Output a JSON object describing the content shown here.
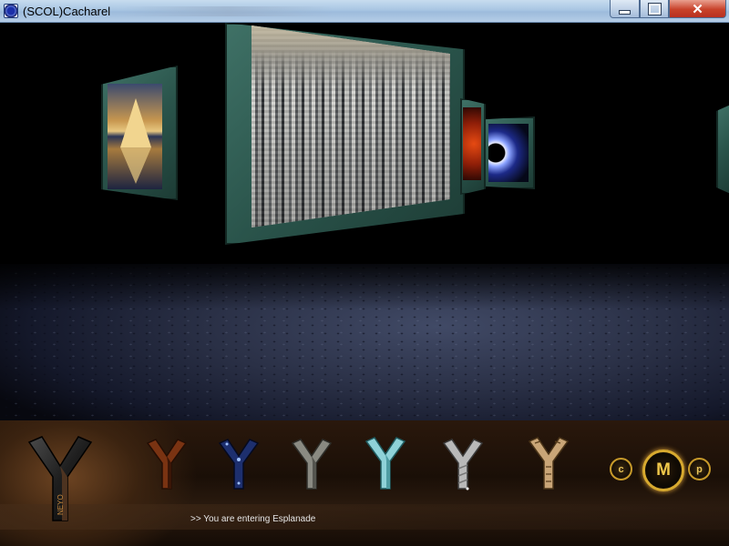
{
  "window": {
    "title": "(SCOL)Cacharel",
    "buttons": {
      "minimize": "minimize",
      "maximize": "maximize",
      "close": "✕"
    }
  },
  "scene": {
    "pictures": [
      "iceberg-picture",
      "city-skyline-picture",
      "red-nebula-picture",
      "eclipse-picture",
      "partial-frame"
    ]
  },
  "toolbar": {
    "main_logo_label": "NEYO",
    "nav_icons": [
      {
        "name": "rust-y-icon",
        "color": "#7a3312"
      },
      {
        "name": "blue-y-icon",
        "color": "#1d2f6e"
      },
      {
        "name": "stone-y-icon",
        "color": "#8a8a82"
      },
      {
        "name": "ice-y-icon",
        "color": "#8fd2d8"
      },
      {
        "name": "silver-y-icon",
        "color": "#b9b9b9"
      },
      {
        "name": "carved-y-icon",
        "color": "#c9a577"
      }
    ],
    "mode_buttons": {
      "c": "c",
      "m": "M",
      "p": "p"
    },
    "status": ">> You are entering Esplanade"
  }
}
